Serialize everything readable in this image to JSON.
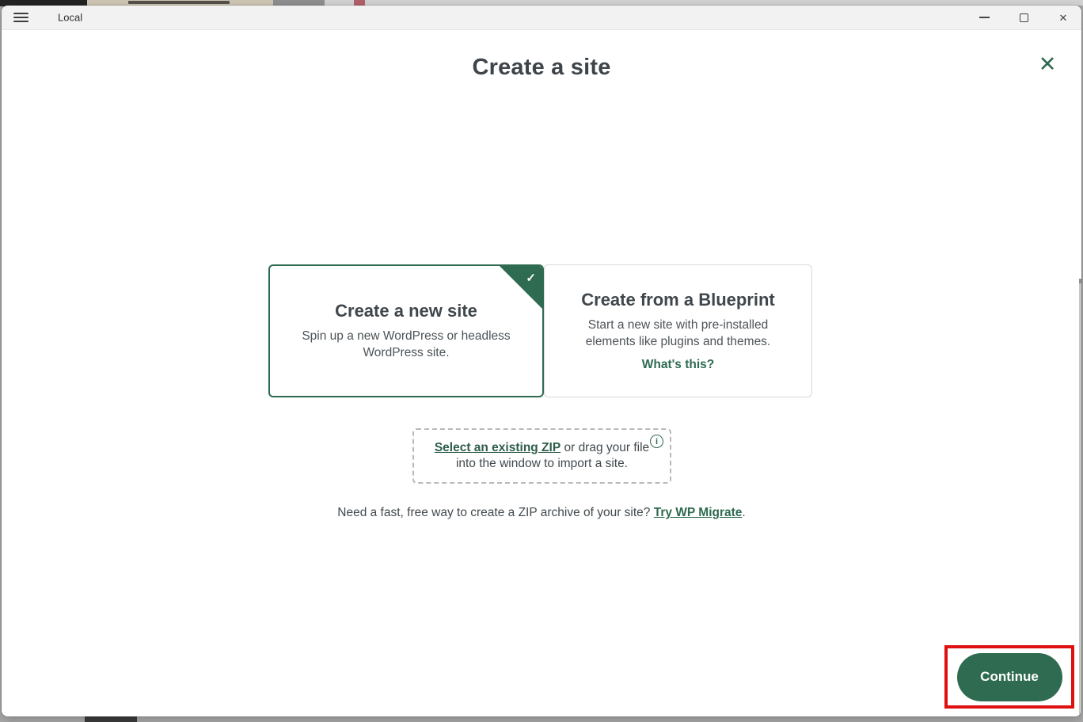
{
  "colors": {
    "brand_green": "#2e6b51",
    "annotation_red": "#df1010",
    "titlebar_bg": "#f2f2f2"
  },
  "titlebar": {
    "app_title": "Local"
  },
  "dialog": {
    "title": "Create a site",
    "close_glyph": "✕",
    "options": [
      {
        "title": "Create a new site",
        "description": "Spin up a new WordPress or headless WordPress site.",
        "selected": true,
        "check_glyph": "✓"
      },
      {
        "title": "Create from a Blueprint",
        "description": "Start a new site with pre-installed elements like plugins and themes.",
        "link_label": "What's this?",
        "selected": false
      }
    ],
    "zip_import": {
      "link_label": "Select an existing ZIP",
      "rest_text": " or drag your file into the window to import a site.",
      "info_glyph": "i"
    },
    "migrate_hint": {
      "prefix": "Need a fast, free way to create a ZIP archive of your site? ",
      "link_label": "Try WP Migrate",
      "suffix": "."
    },
    "footer": {
      "continue_label": "Continue"
    }
  }
}
